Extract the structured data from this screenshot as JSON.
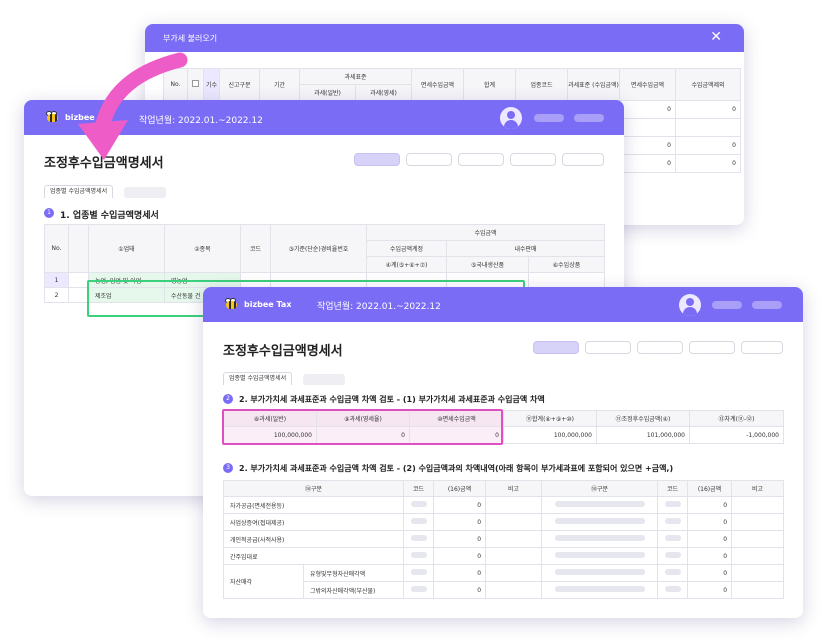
{
  "back_window": {
    "title": "부가세 불러오기",
    "headers": {
      "no": "No.",
      "gisu": "기수",
      "report_type": "신고구분",
      "period": "기간",
      "tax_base": "과세표준",
      "tax_general": "과세(일반)",
      "tax_zero": "과세(영세)",
      "exempt_amount": "면세수입금액",
      "total": "합계",
      "biz_code": "업종코드",
      "tax_base_income": "과세표준 (수입금액)",
      "exempt_income": "면세수입금액",
      "income_excluded": "수입금액제외"
    },
    "values": [
      "0",
      "0",
      "0",
      "0",
      "0",
      "0"
    ]
  },
  "middle_window": {
    "brand": "bizbee",
    "period": "작업년월: 2022.01.~2022.12",
    "page_title": "조정후수입금액명세서",
    "tab_active": "업종별 수입금액명세서",
    "section1_num": "1",
    "section1_title": "1. 업종별 수입금액명세서",
    "headers": {
      "no": "No.",
      "business": "①업태",
      "item": "②종목",
      "code": "코드",
      "standard": "③기준(단순)경비율번호",
      "income": "수입금액",
      "income_account": "수입금액계정",
      "domestic_sales": "내수판매",
      "total": "④계(⑤+⑥+⑦)",
      "domestic_products": "⑤국내생산품",
      "import_goods": "⑥수입상품"
    },
    "rows": [
      {
        "no": "1",
        "business": "농업, 임업 및 어업",
        "item": "영농업"
      },
      {
        "no": "2",
        "business": "제조업",
        "item": "수산동물 건"
      }
    ]
  },
  "front_window": {
    "brand": "bizbee Tax",
    "period": "작업년월: 2022.01.~2022.12",
    "page_title": "조정후수입금액명세서",
    "tab_active": "업종별 수입금액명세서",
    "section2_num": "2",
    "section2_title": "2. 부가가치세 과세표준과 수입금액 차액 검토 - (1) 부가가치세 과세표준과 수입금액 차액",
    "table2_headers": [
      "⑧과세(일반)",
      "⑨과세(영세율)",
      "⑩면세수입금액",
      "⑪합계(⑧+⑨+⑩)",
      "⑪조정후수입금액(④)",
      "⑬차계(⑪-⑫)"
    ],
    "table2_values": [
      "100,000,000",
      "0",
      "0",
      "100,000,000",
      "101,000,000",
      "-1,000,000"
    ],
    "section3_num": "3",
    "section3_title": "2. 부가가치세 과세표준과 수입금액 차액 검토 - (2) 수입금액과의 차액내역(아래 항목이 부가세과표에 포함되어 있으면 +금액,)",
    "table3_headers": {
      "category": "⑭구분",
      "code": "코드",
      "amount": "(16)금액",
      "note": "비고",
      "category2": "⑭구분",
      "code2": "코드",
      "amount2": "(16)금액",
      "note2": "비고"
    },
    "table3_rows": [
      {
        "label": "자가공급(면세전용등)",
        "sub": "",
        "left": "0",
        "right": "0"
      },
      {
        "label": "사업상증여(접대제공)",
        "sub": "",
        "left": "0",
        "right": "0"
      },
      {
        "label": "개인적공급(사적사용)",
        "sub": "",
        "left": "0",
        "right": "0"
      },
      {
        "label": "간주임대료",
        "sub": "",
        "left": "0",
        "right": "0"
      },
      {
        "label": "자산매각",
        "sub": "유형및무형자산매각액",
        "left": "0",
        "right": "0"
      },
      {
        "label": "",
        "sub": "그밖의자산매각액(부산물)",
        "left": "0",
        "right": "0"
      }
    ]
  },
  "colors": {
    "brand_purple": "#7b6cf6",
    "pink_highlight": "#e04fc0",
    "green_highlight": "#3ccf7c",
    "arrow": "#ee5cc8"
  }
}
